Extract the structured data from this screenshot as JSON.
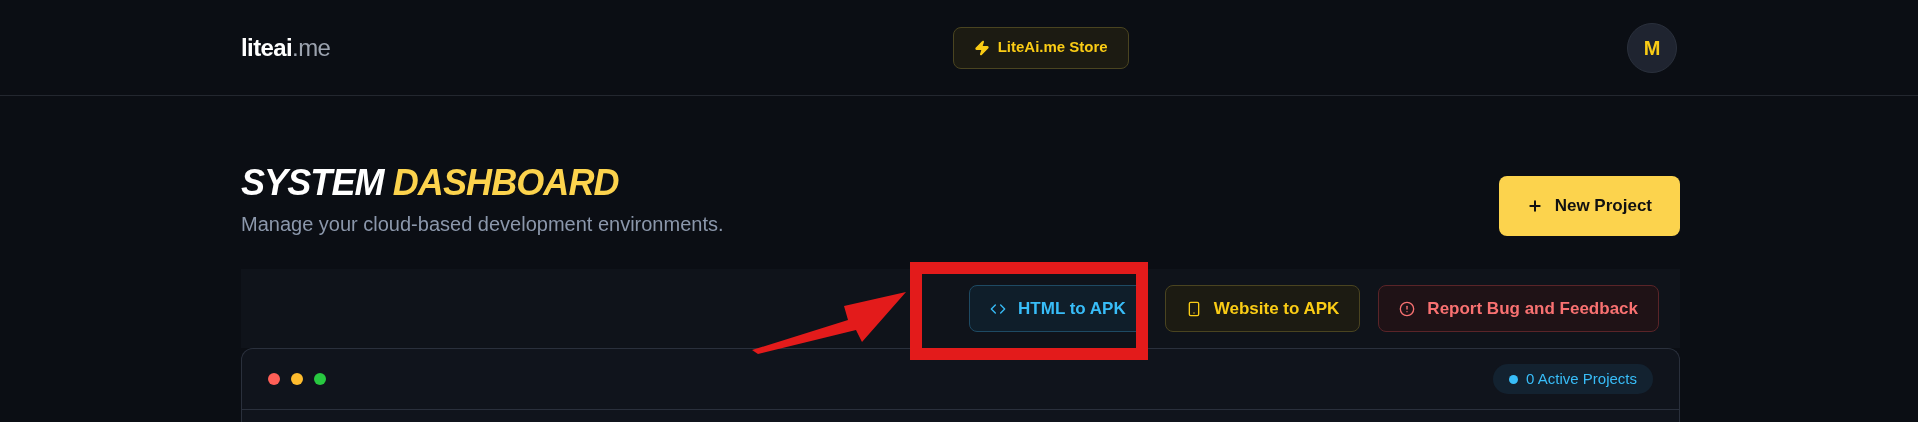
{
  "header": {
    "logo": {
      "name": "liteai",
      "suffix": ".me"
    },
    "store_button": "LiteAi.me Store",
    "avatar": "M"
  },
  "title": {
    "part_1": "SYSTEM",
    "part_2": "DASHBOARD",
    "subtitle": "Manage your cloud-based development environments."
  },
  "new_project_button": "New Project",
  "toolbar": [
    {
      "kind": "code",
      "label": "HTML to APK"
    },
    {
      "kind": "phone",
      "label": "Website to APK"
    },
    {
      "kind": "alert",
      "label": "Report Bug and Feedback"
    }
  ],
  "projects_panel": {
    "badge": "0 Active Projects"
  }
}
